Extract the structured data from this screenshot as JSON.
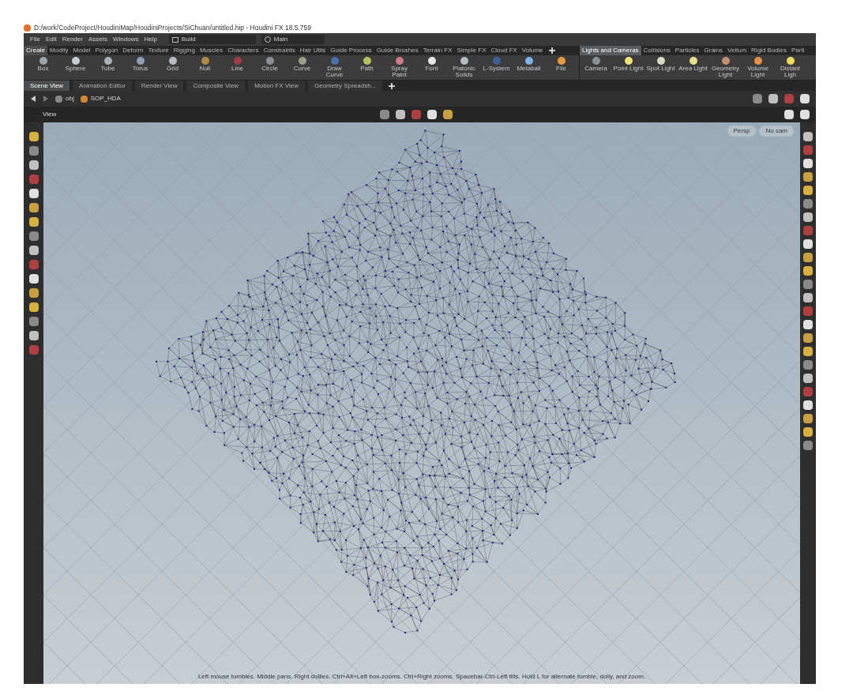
{
  "window": {
    "title": "D:/work/CodeProject/HoudiniMap/HoudiniProjects/SiChuan/untitled.hip - Houdini FX 18.5.759"
  },
  "menu": [
    "File",
    "Edit",
    "Render",
    "Assets",
    "Windows",
    "Help"
  ],
  "desktop": {
    "value": "Build"
  },
  "pane_link": {
    "value": "Main"
  },
  "shelf_tabs": [
    {
      "label": "Create",
      "selected": true
    },
    {
      "label": "Modify",
      "selected": false
    },
    {
      "label": "Model",
      "selected": false
    },
    {
      "label": "Polygon",
      "selected": false
    },
    {
      "label": "Deform",
      "selected": false
    },
    {
      "label": "Texture",
      "selected": false
    },
    {
      "label": "Rigging",
      "selected": false
    },
    {
      "label": "Muscles",
      "selected": false
    },
    {
      "label": "Characters",
      "selected": false
    },
    {
      "label": "Constraints",
      "selected": false
    },
    {
      "label": "Hair Utils",
      "selected": false
    },
    {
      "label": "Guide Process",
      "selected": false
    },
    {
      "label": "Guide Brushes",
      "selected": false
    },
    {
      "label": "Terrain FX",
      "selected": false
    },
    {
      "label": "Simple FX",
      "selected": false
    },
    {
      "label": "Cloud FX",
      "selected": false
    },
    {
      "label": "Volume",
      "selected": false
    }
  ],
  "shelf_tools": [
    {
      "label": "Box",
      "color": "#9aa4ad"
    },
    {
      "label": "Sphere",
      "color": "#c7ccd1"
    },
    {
      "label": "Tube",
      "color": "#aab2b9"
    },
    {
      "label": "Torus",
      "color": "#8fa0b0"
    },
    {
      "label": "Grid",
      "color": "#b8bcc0"
    },
    {
      "label": "Null",
      "color": "#b08a4a"
    },
    {
      "label": "Line",
      "color": "#a03a44"
    },
    {
      "label": "Circle",
      "color": "#8a8f94"
    },
    {
      "label": "Curve",
      "color": "#9a9f88"
    },
    {
      "label": "Draw Curve",
      "color": "#4d6fae"
    },
    {
      "label": "Path",
      "color": "#b6c25a"
    },
    {
      "label": "Spray Paint",
      "color": "#d07a86"
    },
    {
      "label": "Font",
      "color": "#e6e6e6"
    },
    {
      "label": "Platonic Solids",
      "color": "#b7bcc2"
    },
    {
      "label": "L-System",
      "color": "#3a5f9a"
    },
    {
      "label": "Metaball",
      "color": "#7fb2e6"
    },
    {
      "label": "File",
      "color": "#e59a40"
    }
  ],
  "right_shelf_tabs": [
    {
      "label": "Lights and Cameras",
      "selected": true
    },
    {
      "label": "Collisions",
      "selected": false
    },
    {
      "label": "Particles",
      "selected": false
    },
    {
      "label": "Grains",
      "selected": false
    },
    {
      "label": "Vellum",
      "selected": false
    },
    {
      "label": "Rigid Bodies",
      "selected": false
    },
    {
      "label": "Parti",
      "selected": false
    }
  ],
  "right_shelf_tools": [
    {
      "label": "Camera",
      "color": "#8d9196"
    },
    {
      "label": "Point Light",
      "color": "#f2e27a"
    },
    {
      "label": "Spot Light",
      "color": "#d8dcc0"
    },
    {
      "label": "Area Light",
      "color": "#e8e08a"
    },
    {
      "label": "Geometry Light",
      "color": "#c09070"
    },
    {
      "label": "Volume Light",
      "color": "#e8904a"
    },
    {
      "label": "Distant Ligh",
      "color": "#f0dc5a"
    }
  ],
  "pane_tabs": [
    {
      "label": "Scene View",
      "selected": true
    },
    {
      "label": "Animation Editor",
      "selected": false
    },
    {
      "label": "Render View",
      "selected": false
    },
    {
      "label": "Composite View",
      "selected": false
    },
    {
      "label": "Motion FX View",
      "selected": false
    },
    {
      "label": "Geometry Spreadsh...",
      "selected": false
    }
  ],
  "path": [
    "obj",
    "SOP_HDA"
  ],
  "viewport": {
    "title": "View",
    "camera_menus": [
      "Persp",
      "No cam"
    ],
    "status": "Left mouse tumbles. Middle pans. Right dollies. Ctrl+Alt+Left box-zooms. Ctrl+Right zooms. Spacebar-Ctrl-Left tilts. Hold L for alternate tumble, dolly, and zoom."
  }
}
